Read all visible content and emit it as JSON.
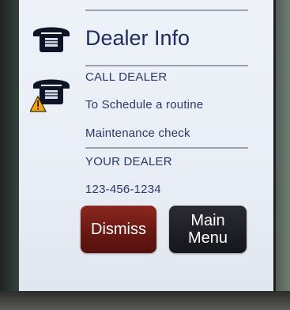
{
  "header": {
    "title": "Dealer Info"
  },
  "message": {
    "line1": "CALL DEALER",
    "line2": "To Schedule a routine",
    "line3": "Maintenance check",
    "line4": "YOUR DEALER",
    "phone": "123-456-1234"
  },
  "buttons": {
    "dismiss_label": "Dismiss",
    "main_menu_label": "Main\nMenu"
  },
  "icons": {
    "header_icon": "phone-icon",
    "alert_icon": "phone-warning-icon"
  },
  "colors": {
    "text": "#2c3868",
    "title": "#1f2d63",
    "dismiss_bg": "#6a1812",
    "main_menu_bg": "#15161c",
    "warning": "#f2a51a"
  }
}
